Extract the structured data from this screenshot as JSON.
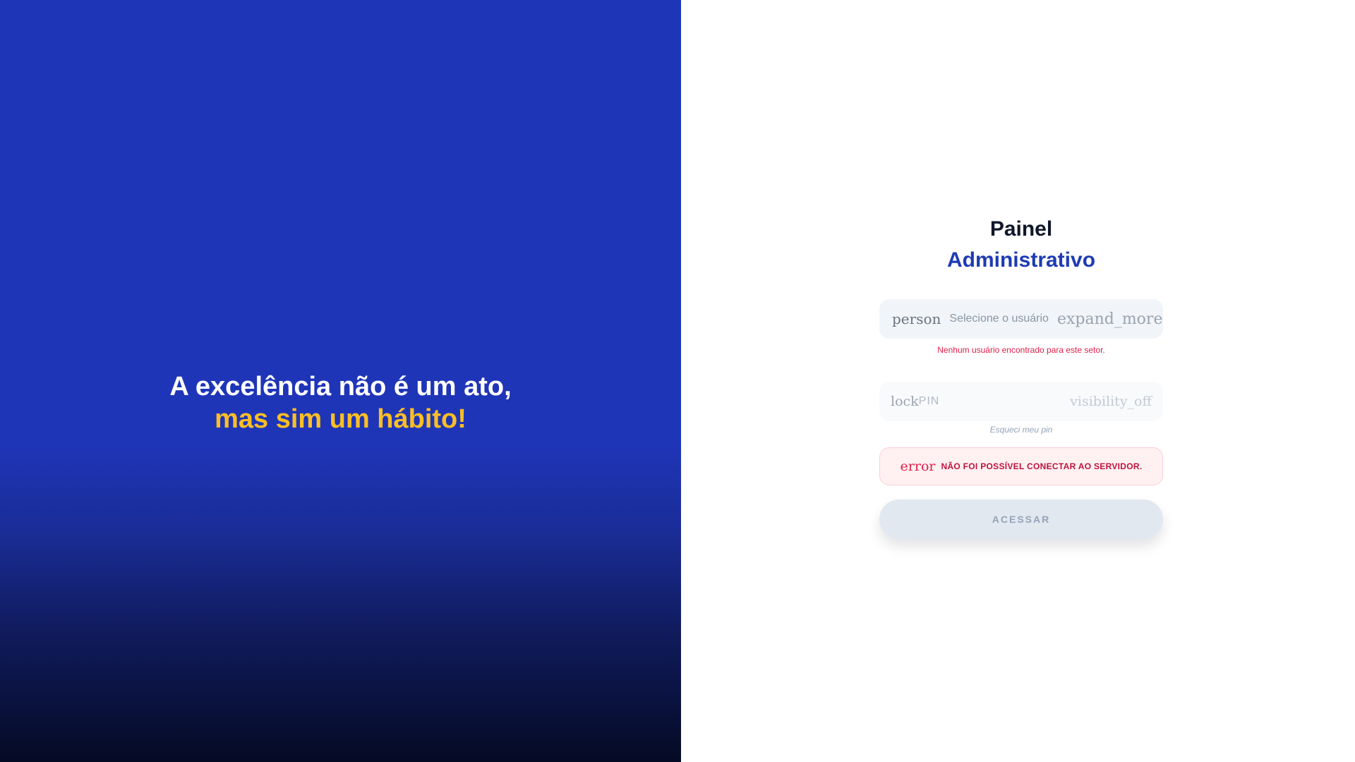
{
  "hero": {
    "quote_line1": "A excelência não é um ato,",
    "quote_line2": "mas sim um hábito!"
  },
  "login": {
    "title_line1": "Painel",
    "title_line2": "Administrativo",
    "user_field": {
      "icon": "person",
      "placeholder": "Selecione o usuário",
      "dropdown_icon": "expand_more",
      "error": "Nenhum usuário encontrado para este setor."
    },
    "pin_field": {
      "icon": "lock",
      "placeholder": "PIN",
      "toggle_icon": "visibility_off"
    },
    "forgot_link": "Esqueci meu pin",
    "alert": {
      "icon": "error",
      "message": "NÃO FOI POSSÍVEL CONECTAR AO SERVIDOR."
    },
    "submit_label": "ACESSAR"
  },
  "colors": {
    "hero_blue": "#1f35b8",
    "accent_yellow": "#fbbf24",
    "title_blue": "#1e3bb3",
    "error_red": "#e11d48"
  }
}
